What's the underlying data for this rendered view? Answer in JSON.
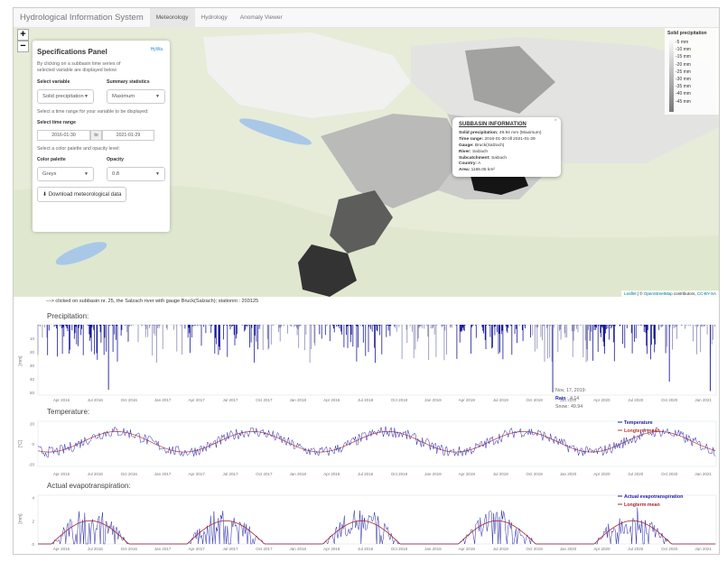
{
  "navbar": {
    "brand": "Hydrological Information System",
    "tabs": [
      "Meteorology",
      "Hydrology",
      "Anomaly Viewer"
    ]
  },
  "map": {
    "zoom_in": "+",
    "zoom_out": "−",
    "attribution": {
      "leaflet": "Leaflet",
      "sep": " | © ",
      "osm": "OpenStreetMap",
      "contrib": " contributors, ",
      "license": "CC-BY-SA"
    }
  },
  "panel": {
    "title": "Specifications Panel",
    "logo": "HyWa",
    "intro": "By clicking on a subbasin time series of selected variable are displayed below",
    "variable_label": "Select variable",
    "variable_value": "Solid precipitation",
    "stat_label": "Summary statistics",
    "stat_value": "Maximum",
    "time_intro": "Select a time range for your variable to be displayed:",
    "time_label": "Select time range",
    "date_from": "2016-01-30",
    "date_sep": "to",
    "date_to": "2021-01-29",
    "palette_intro": "Select a color palette and opacity level:",
    "palette_label": "Color palette",
    "palette_value": "Greys",
    "opacity_label": "Opacity",
    "opacity_value": "0.8",
    "download": "Download meteorological data"
  },
  "legend": {
    "title": "Solid precipitation",
    "ticks": [
      "5 mm",
      "10 mm",
      "15 mm",
      "20 mm",
      "25 mm",
      "30 mm",
      "35 mm",
      "40 mm",
      "45 mm"
    ]
  },
  "popup": {
    "title": "SUBBASIN INFORMATION",
    "rows": [
      {
        "k": "Solid precipitation:",
        "v": " 49.94 mm (Maximum)"
      },
      {
        "k": "Time range:",
        "v": " 2016-01-30 till 2021-01-29"
      },
      {
        "k": "Gauge:",
        "v": " Bruck(Salzach)"
      },
      {
        "k": "River:",
        "v": " Salzach"
      },
      {
        "k": "Subcatchment:",
        "v": " Salzach"
      },
      {
        "k": "Country:",
        "v": " A"
      },
      {
        "k": "Area:",
        "v": " 1166.05 km²"
      }
    ]
  },
  "click_info": "---> clicked on subbasin nr. 25, the Salzach river with gauge Bruck(Salzach); stationnr.: 203125",
  "x_ticks": [
    "Apr 2016",
    "Jul 2016",
    "Oct 2016",
    "Jan 2017",
    "Apr 2017",
    "Jul 2017",
    "Oct 2017",
    "Jan 2018",
    "Apr 2018",
    "Jul 2018",
    "Oct 2018",
    "Jan 2019",
    "Apr 2019",
    "Jul 2019",
    "Oct 2019",
    "Jan 2020",
    "Apr 2020",
    "Jul 2020",
    "Oct 2020",
    "Jan 2021"
  ],
  "charts": {
    "precip": {
      "title": "Precipitation:",
      "ylabel": "[mm]",
      "yticks": [
        "10",
        "20",
        "30",
        "40",
        "50"
      ],
      "colors": {
        "rain": "#1a1a9a",
        "snow": "#8888b8"
      },
      "tooltip": {
        "date": "Nov, 17, 2019:",
        "rain_label": "Rain",
        "rain_value": ": 4.14",
        "snow_label": "Snow",
        "snow_value": ": 49.94"
      }
    },
    "temp": {
      "title": "Temperature:",
      "ylabel": "[°C]",
      "yticks": [
        "20",
        "0",
        "-20"
      ],
      "legend": [
        "Temperature",
        "Longterm mean"
      ],
      "colors": {
        "obs": "#2222aa",
        "mean": "#c0392b"
      }
    },
    "et": {
      "title": "Actual evapotranspiration:",
      "ylabel": "[mm]",
      "yticks": [
        "4",
        "2",
        "0"
      ],
      "legend": [
        "Actual evapotranspiration",
        "Longterm mean"
      ],
      "colors": {
        "obs": "#2222aa",
        "mean": "#a52a2a"
      }
    }
  }
}
